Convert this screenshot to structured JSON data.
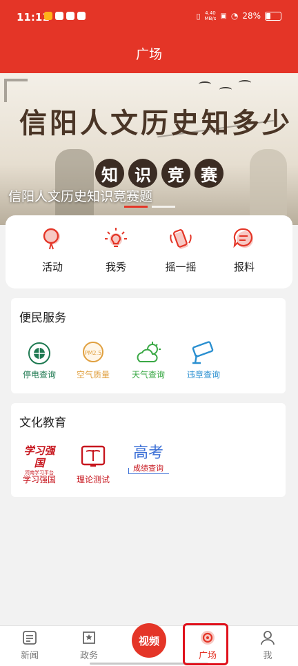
{
  "status_bar": {
    "time": "11:11",
    "net_speed_value": "4.40",
    "net_speed_unit": "MB/s",
    "battery": "28%"
  },
  "header": {
    "title": "广场"
  },
  "banner": {
    "title_art": "信阳人文历史知多少",
    "badge_chars": [
      "知",
      "识",
      "竞",
      "赛"
    ],
    "caption": "信阳人文历史知识竞赛题",
    "slide_count": 2,
    "active_slide": 1
  },
  "quick_actions": [
    {
      "label": "活动",
      "icon": "balloon-icon"
    },
    {
      "label": "我秀",
      "icon": "lightbulb-icon"
    },
    {
      "label": "摇一摇",
      "icon": "phone-shake-icon"
    },
    {
      "label": "报料",
      "icon": "chat-bubble-icon"
    }
  ],
  "convenience": {
    "title": "便民服务",
    "items": [
      {
        "label": "停电查询",
        "icon": "power-grid-icon",
        "color": "#1f7a52"
      },
      {
        "label": "空气质量",
        "icon": "pm25-icon",
        "color": "#e0a040",
        "badge": "PM2.5"
      },
      {
        "label": "天气查询",
        "icon": "weather-icon",
        "color": "#3aa845"
      },
      {
        "label": "违章查询",
        "icon": "traffic-camera-icon",
        "color": "#2a8fd0"
      }
    ]
  },
  "education": {
    "title": "文化教育",
    "items": [
      {
        "label": "学习强国",
        "icon": "xuexi-qiangguo-logo",
        "color": "#c7161e",
        "logo_text": "学习强国",
        "logo_sub": "河南学习平台"
      },
      {
        "label": "理论测试",
        "icon": "book-icon",
        "color": "#c7161e"
      },
      {
        "label": "成绩查询",
        "icon": "gaokao-logo",
        "color": "#c7161e",
        "logo_text": "高考"
      }
    ]
  },
  "bottom_nav": [
    {
      "label": "新闻",
      "icon": "news-icon"
    },
    {
      "label": "政务",
      "icon": "government-icon"
    },
    {
      "label": "视频",
      "icon": "video-button"
    },
    {
      "label": "广场",
      "icon": "square-icon",
      "active": true
    },
    {
      "label": "我",
      "icon": "profile-icon"
    }
  ],
  "colors": {
    "brand_red": "#e43527",
    "highlight_red": "#e0111c"
  }
}
